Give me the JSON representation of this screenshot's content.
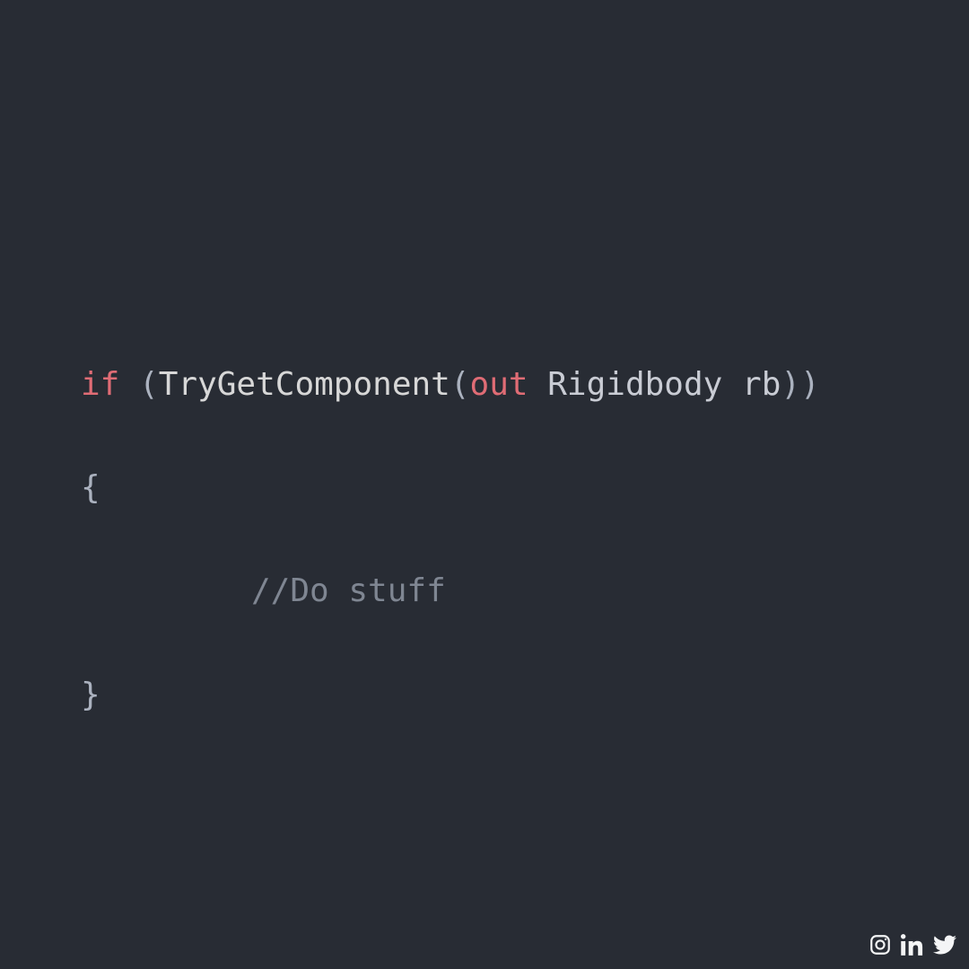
{
  "colors": {
    "bg": "#282c34",
    "keyword": "#e06c75",
    "default": "#abb2bf",
    "comment": "#7f8692"
  },
  "code": {
    "line1": {
      "kw_if": "if",
      "space1": " ",
      "open_paren": "(",
      "fn": "TryGetComponent",
      "open_paren2": "(",
      "kw_out": "out",
      "space2": " ",
      "type": "Rigidbody",
      "space3": " ",
      "var": "rb",
      "close_parens": "))"
    },
    "line2": {
      "brace_open": "{"
    },
    "line3": {
      "comment": "//Do stuff"
    },
    "line4": {
      "brace_close": "}"
    }
  },
  "social": {
    "icons": [
      "instagram",
      "linkedin",
      "twitter"
    ]
  }
}
